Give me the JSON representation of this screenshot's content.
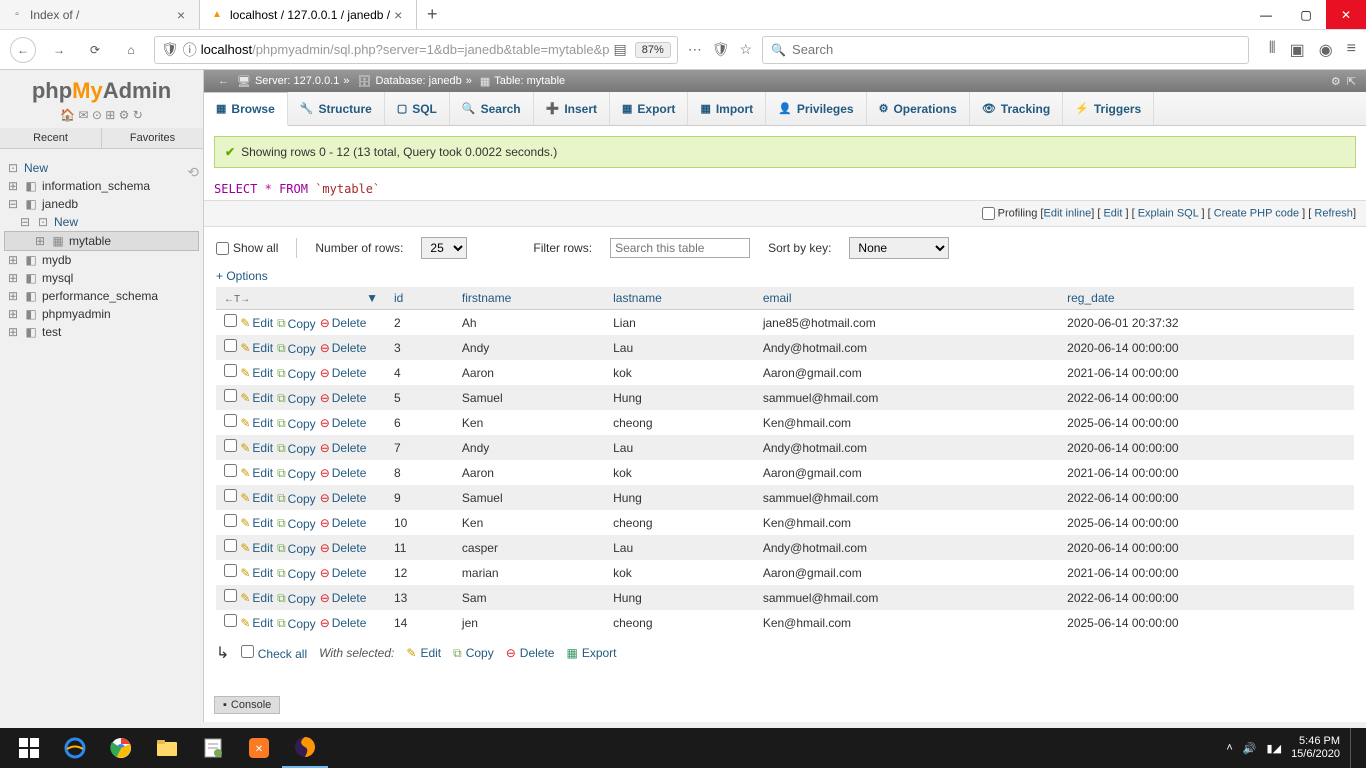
{
  "browser": {
    "tabs": [
      {
        "title": "Index of /"
      },
      {
        "title": "localhost / 127.0.0.1 / janedb /",
        "active": true
      }
    ],
    "url_prefix": "localhost",
    "url_rest": "/phpmyadmin/sql.php?server=1&db=janedb&table=mytable&p",
    "zoom": "87%",
    "search_placeholder": "Search"
  },
  "pma": {
    "logo_parts": {
      "a": "php",
      "b": "My",
      "c": "Admin"
    },
    "side_tabs": {
      "recent": "Recent",
      "fav": "Favorites"
    },
    "tree": {
      "new": "New",
      "dbs": [
        "information_schema",
        "janedb",
        "mydb",
        "mysql",
        "performance_schema",
        "phpmyadmin",
        "test"
      ],
      "janedb_children": {
        "new": "New",
        "table": "mytable"
      }
    },
    "breadcrumb": {
      "server": "Server: 127.0.0.1",
      "db": "Database: janedb",
      "table": "Table: mytable"
    },
    "tabs": [
      "Browse",
      "Structure",
      "SQL",
      "Search",
      "Insert",
      "Export",
      "Import",
      "Privileges",
      "Operations",
      "Tracking",
      "Triggers"
    ],
    "notice": "Showing rows 0 - 12 (13 total, Query took 0.0022 seconds.)",
    "sql": {
      "select": "SELECT",
      "star": "*",
      "from": "FROM",
      "table": "`mytable`"
    },
    "links": {
      "profiling": "Profiling",
      "edit_inline": "Edit inline",
      "edit": "Edit",
      "explain": "Explain SQL",
      "php": "Create PHP code",
      "refresh": "Refresh"
    },
    "filter": {
      "show_all": "Show all",
      "num_rows_label": "Number of rows:",
      "num_rows_value": "25",
      "filter_label": "Filter rows:",
      "filter_ph": "Search this table",
      "sort_label": "Sort by key:",
      "sort_value": "None"
    },
    "options": "+ Options",
    "columns": [
      "id",
      "firstname",
      "lastname",
      "email",
      "reg_date"
    ],
    "actions": {
      "edit": "Edit",
      "copy": "Copy",
      "delete": "Delete"
    },
    "rows": [
      {
        "id": "2",
        "firstname": "Ah",
        "lastname": "Lian",
        "email": "jane85@hotmail.com",
        "reg_date": "2020-06-01 20:37:32"
      },
      {
        "id": "3",
        "firstname": "Andy",
        "lastname": "Lau",
        "email": "Andy@hotmail.com",
        "reg_date": "2020-06-14 00:00:00"
      },
      {
        "id": "4",
        "firstname": "Aaron",
        "lastname": "kok",
        "email": "Aaron@gmail.com",
        "reg_date": "2021-06-14 00:00:00"
      },
      {
        "id": "5",
        "firstname": "Samuel",
        "lastname": "Hung",
        "email": "sammuel@hmail.com",
        "reg_date": "2022-06-14 00:00:00"
      },
      {
        "id": "6",
        "firstname": "Ken",
        "lastname": "cheong",
        "email": "Ken@hmail.com",
        "reg_date": "2025-06-14 00:00:00"
      },
      {
        "id": "7",
        "firstname": "Andy",
        "lastname": "Lau",
        "email": "Andy@hotmail.com",
        "reg_date": "2020-06-14 00:00:00"
      },
      {
        "id": "8",
        "firstname": "Aaron",
        "lastname": "kok",
        "email": "Aaron@gmail.com",
        "reg_date": "2021-06-14 00:00:00"
      },
      {
        "id": "9",
        "firstname": "Samuel",
        "lastname": "Hung",
        "email": "sammuel@hmail.com",
        "reg_date": "2022-06-14 00:00:00"
      },
      {
        "id": "10",
        "firstname": "Ken",
        "lastname": "cheong",
        "email": "Ken@hmail.com",
        "reg_date": "2025-06-14 00:00:00"
      },
      {
        "id": "11",
        "firstname": "casper",
        "lastname": "Lau",
        "email": "Andy@hotmail.com",
        "reg_date": "2020-06-14 00:00:00"
      },
      {
        "id": "12",
        "firstname": "marian",
        "lastname": "kok",
        "email": "Aaron@gmail.com",
        "reg_date": "2021-06-14 00:00:00"
      },
      {
        "id": "13",
        "firstname": "Sam",
        "lastname": "Hung",
        "email": "sammuel@hmail.com",
        "reg_date": "2022-06-14 00:00:00"
      },
      {
        "id": "14",
        "firstname": "jen",
        "lastname": "cheong",
        "email": "Ken@hmail.com",
        "reg_date": "2025-06-14 00:00:00"
      }
    ],
    "bulk": {
      "check_all": "Check all",
      "with_selected": "With selected:",
      "edit": "Edit",
      "copy": "Copy",
      "delete": "Delete",
      "export": "Export"
    },
    "console": "Console"
  },
  "taskbar": {
    "time": "5:46 PM",
    "date": "15/6/2020"
  }
}
